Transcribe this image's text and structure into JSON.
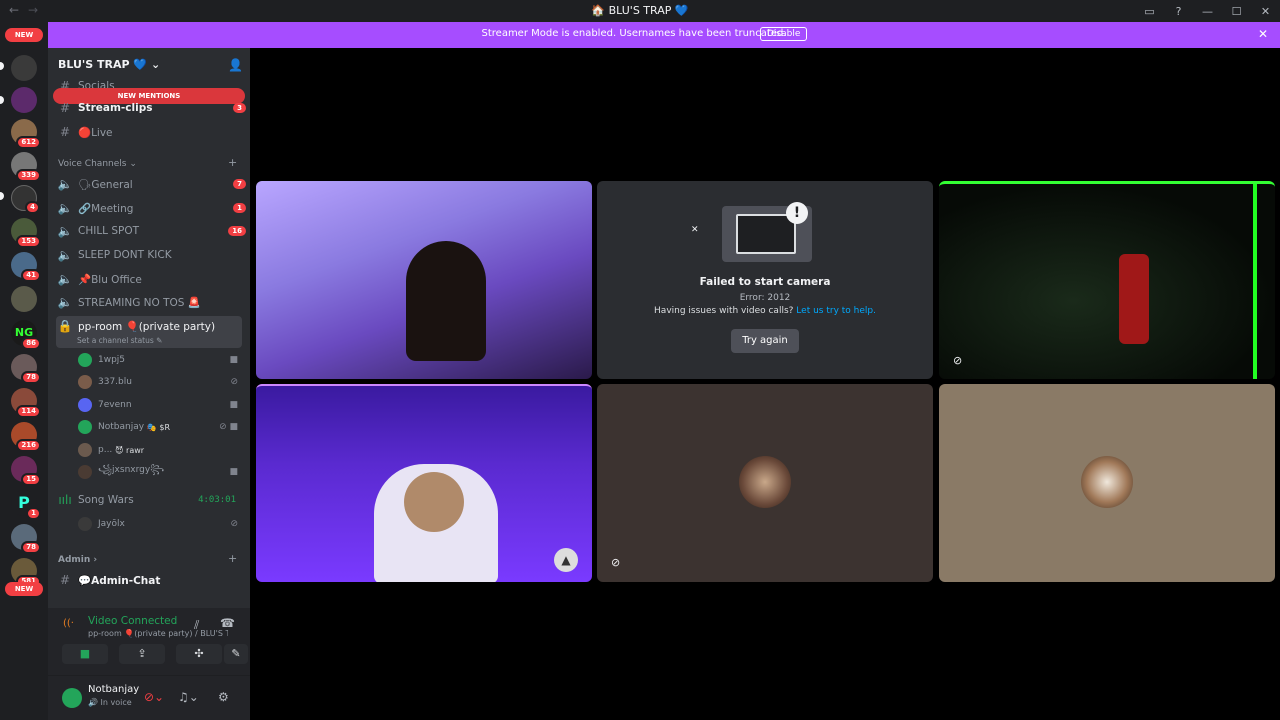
{
  "window": {
    "title": "🏠 BLU'S TRAP 💙",
    "back": "←",
    "forward": "→"
  },
  "banner": {
    "message": "Streamer Mode is enabled. Usernames have been truncated.",
    "button": "Disable"
  },
  "servers": {
    "new_top": "NEW",
    "new_bottom": "NEW",
    "badges": [
      "612",
      "339",
      "4",
      "153",
      "41",
      "86",
      "78",
      "114",
      "216",
      "15",
      "1",
      "78",
      "581"
    ]
  },
  "guild": {
    "name": "BLU'S TRAP 💙"
  },
  "text_channels": [
    {
      "name": "Socials"
    },
    {
      "name": "Stream-clips",
      "count": "3"
    },
    {
      "name": "🔴Live"
    }
  ],
  "new_mentions": "NEW MENTIONS",
  "voice_category": "Voice Channels",
  "voice_channels": [
    {
      "name": "🗣General",
      "count": "7"
    },
    {
      "name": "🔗Meeting",
      "count": "1"
    },
    {
      "name": "CHILL SPOT",
      "count": "16"
    },
    {
      "name": "SLEEP DONT KICK"
    },
    {
      "name": "📌Blu Office"
    },
    {
      "name": "STREAMING NO TOS 🚨"
    }
  ],
  "current_channel": {
    "name": "pp-room 🎈(private party)",
    "status": "Set a channel status"
  },
  "participants": [
    {
      "name": "1wpj5",
      "color": "#23a55a"
    },
    {
      "name": "337.blu",
      "color": "#7a5c4a"
    },
    {
      "name": "7evenn",
      "color": "#5865f2"
    },
    {
      "name": "Notbanjay",
      "tag": "🎭 $R",
      "color": "#23a55a"
    },
    {
      "name": "p...",
      "tag": "😈 rawr",
      "color": "#6b5a4e"
    },
    {
      "name": "꧁jxsnxrgy꧂",
      "color": "#4a3b33"
    }
  ],
  "song_wars": {
    "name": "Song Wars",
    "time": "4:03:01",
    "member": "Jayōlx"
  },
  "admin_category": "Admin",
  "admin_channel": "💬Admin-Chat",
  "voice_panel": {
    "status": "Video Connected",
    "location": "pp-room 🎈(private party) / BLU'S TRAP 💙"
  },
  "user_panel": {
    "name": "Notbanjay",
    "status": "🔊 In voice"
  },
  "camera_error": {
    "title": "Failed to start camera",
    "code": "Error: 2012",
    "help_prefix": "Having issues with video calls?",
    "help_link": "Let us try to help.",
    "button": "Try again"
  },
  "colors": {
    "accent": "#a64dff",
    "green": "#23a55a",
    "red": "#f23f43",
    "link": "#00a8fc"
  }
}
